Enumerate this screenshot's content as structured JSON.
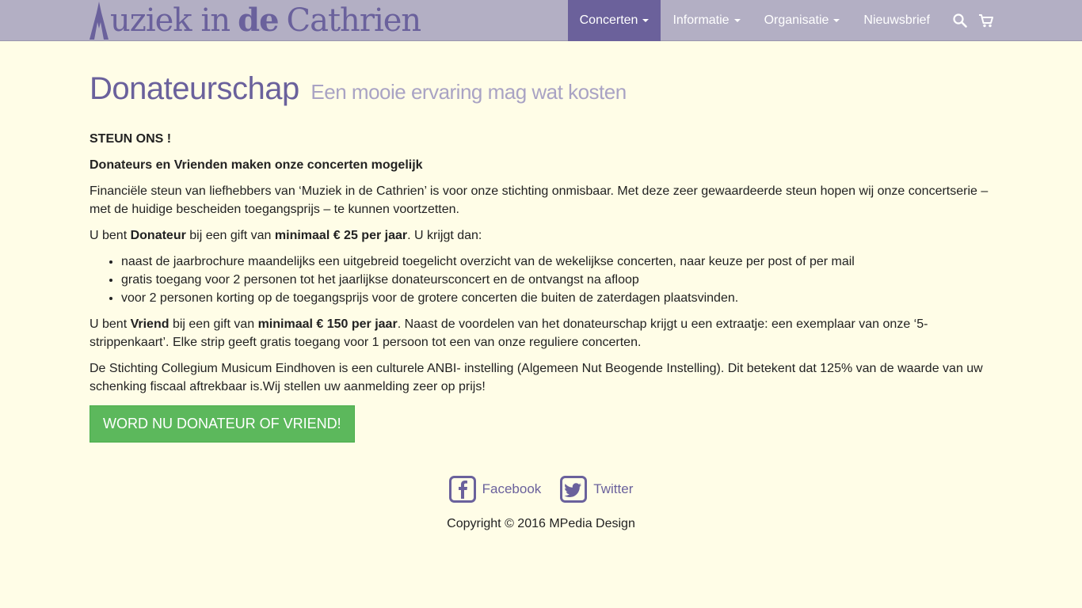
{
  "brand": {
    "logo_word1": "uziek",
    "logo_word2": "in",
    "logo_word3": "de",
    "logo_word4": "Cathrien",
    "color": "#6a619c"
  },
  "nav": {
    "items": [
      {
        "label": "Concerten",
        "dropdown": true,
        "active": true
      },
      {
        "label": "Informatie",
        "dropdown": true,
        "active": false
      },
      {
        "label": "Organisatie",
        "dropdown": true,
        "active": false
      },
      {
        "label": "Nieuwsbrief",
        "dropdown": false,
        "active": false
      }
    ],
    "icons": [
      "search-icon",
      "cart-icon"
    ]
  },
  "page": {
    "title": "Donateurschap",
    "subtitle": "Een mooie ervaring mag wat kosten",
    "steun": "STEUN ONS !",
    "heading": "Donateurs en Vrienden maken onze concerten mogelijk",
    "intro": "Financiële steun van liefhebbers van ‘Muziek in de Cathrien’ is voor onze stichting onmisbaar. Met deze zeer gewaardeerde steun hopen wij onze concertserie – met de huidige bescheiden toegangsprijs – te kunnen voortzetten.",
    "donateur": {
      "t1": "U bent ",
      "b1": "Donateur",
      "t2": " bij een gift van ",
      "b2": "minimaal € 25 per jaar",
      "t3": ". U krijgt dan:"
    },
    "benefits": [
      "naast de jaarbrochure maandelijks een uitgebreid toegelicht overzicht van de wekelijkse concerten, naar keuze per post of per mail",
      "gratis toegang voor 2 personen tot het jaarlijkse donateursconcert en de ontvangst na afloop",
      "voor 2 personen korting op de toegangsprijs voor de grotere concerten die buiten de zaterdagen plaatsvinden."
    ],
    "vriend": {
      "t1": "U bent ",
      "b1": "Vriend",
      "t2": " bij een gift van ",
      "b2": "minimaal € 150 per jaar",
      "t3": ". Naast de voordelen van het donateurschap krijgt u een extraatje: een exemplaar van onze ‘5-strippenkaart’. Elke strip geeft gratis toegang voor 1 persoon tot een van onze reguliere concerten."
    },
    "anbi": "De Stichting Collegium Musicum Eindhoven is een culturele ANBI- instelling (Algemeen Nut Beogende Instelling). Dit betekent dat 125% van de waarde van uw schenking fiscaal aftrekbaar is.Wij stellen uw aanmelding zeer op prijs!",
    "cta": "WORD NU DONATEUR OF VRIEND!",
    "cta_color": "#5cb85c"
  },
  "footer": {
    "facebook": "Facebook",
    "twitter": "Twitter",
    "copyright": "Copyright © 2016 MPedia Design"
  }
}
